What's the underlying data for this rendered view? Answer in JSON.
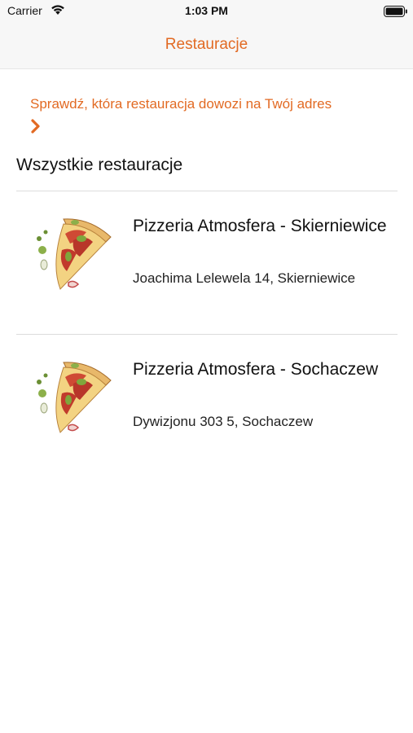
{
  "status_bar": {
    "carrier": "Carrier",
    "time": "1:03 PM"
  },
  "nav": {
    "title": "Restauracje"
  },
  "promo": {
    "text": "Sprawdź, która restauracja dowozi na Twój adres",
    "icon": "chevron-right-icon"
  },
  "section": {
    "title": "Wszystkie restauracje"
  },
  "restaurants": [
    {
      "name": "Pizzeria Atmosfera - Skierniewice",
      "address": "Joachima Lelewela 14, Skierniewice",
      "image": "pizza-slice-image"
    },
    {
      "name": "Pizzeria Atmosfera - Sochaczew",
      "address": "Dywizjonu 303 5, Sochaczew",
      "image": "pizza-slice-image"
    }
  ],
  "colors": {
    "accent": "#e26a23",
    "bar_background": "#f7f7f7",
    "divider": "#dcdcdc"
  }
}
